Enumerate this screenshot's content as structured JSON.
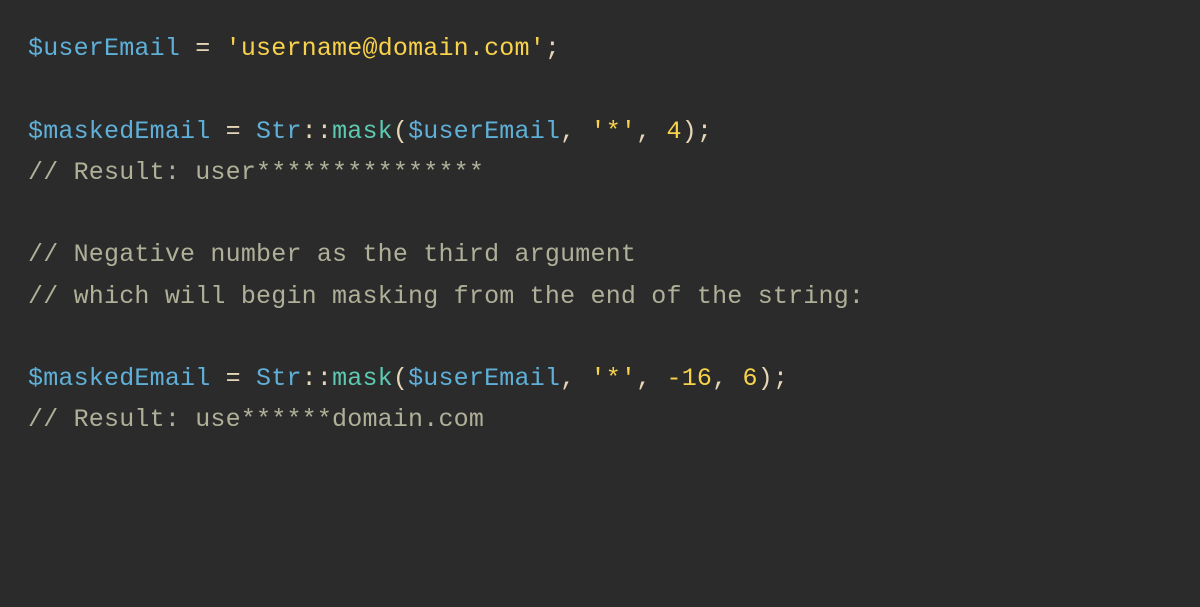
{
  "code": {
    "l1": {
      "var1": "$userEmail",
      "op1": " = ",
      "str1": "'username@domain.com'",
      "op2": ";"
    },
    "l2": {
      "var1": "$maskedEmail",
      "op1": " = ",
      "cls": "Str",
      "dbl": "::",
      "fn": "mask",
      "p1": "(",
      "arg1": "$userEmail",
      "sep1": ", ",
      "str1": "'*'",
      "sep2": ", ",
      "num1": "4",
      "p2": ")",
      "semi": ";"
    },
    "l3": {
      "comment": "// Result: user***************"
    },
    "l4": {
      "comment": "// Negative number as the third argument"
    },
    "l5": {
      "comment": "// which will begin masking from the end of the string:"
    },
    "l6": {
      "var1": "$maskedEmail",
      "op1": " = ",
      "cls": "Str",
      "dbl": "::",
      "fn": "mask",
      "p1": "(",
      "arg1": "$userEmail",
      "sep1": ", ",
      "str1": "'*'",
      "sep2": ", ",
      "num1": "-16",
      "sep3": ", ",
      "num2": "6",
      "p2": ")",
      "semi": ";"
    },
    "l7": {
      "comment": "// Result: use******domain.com"
    }
  }
}
